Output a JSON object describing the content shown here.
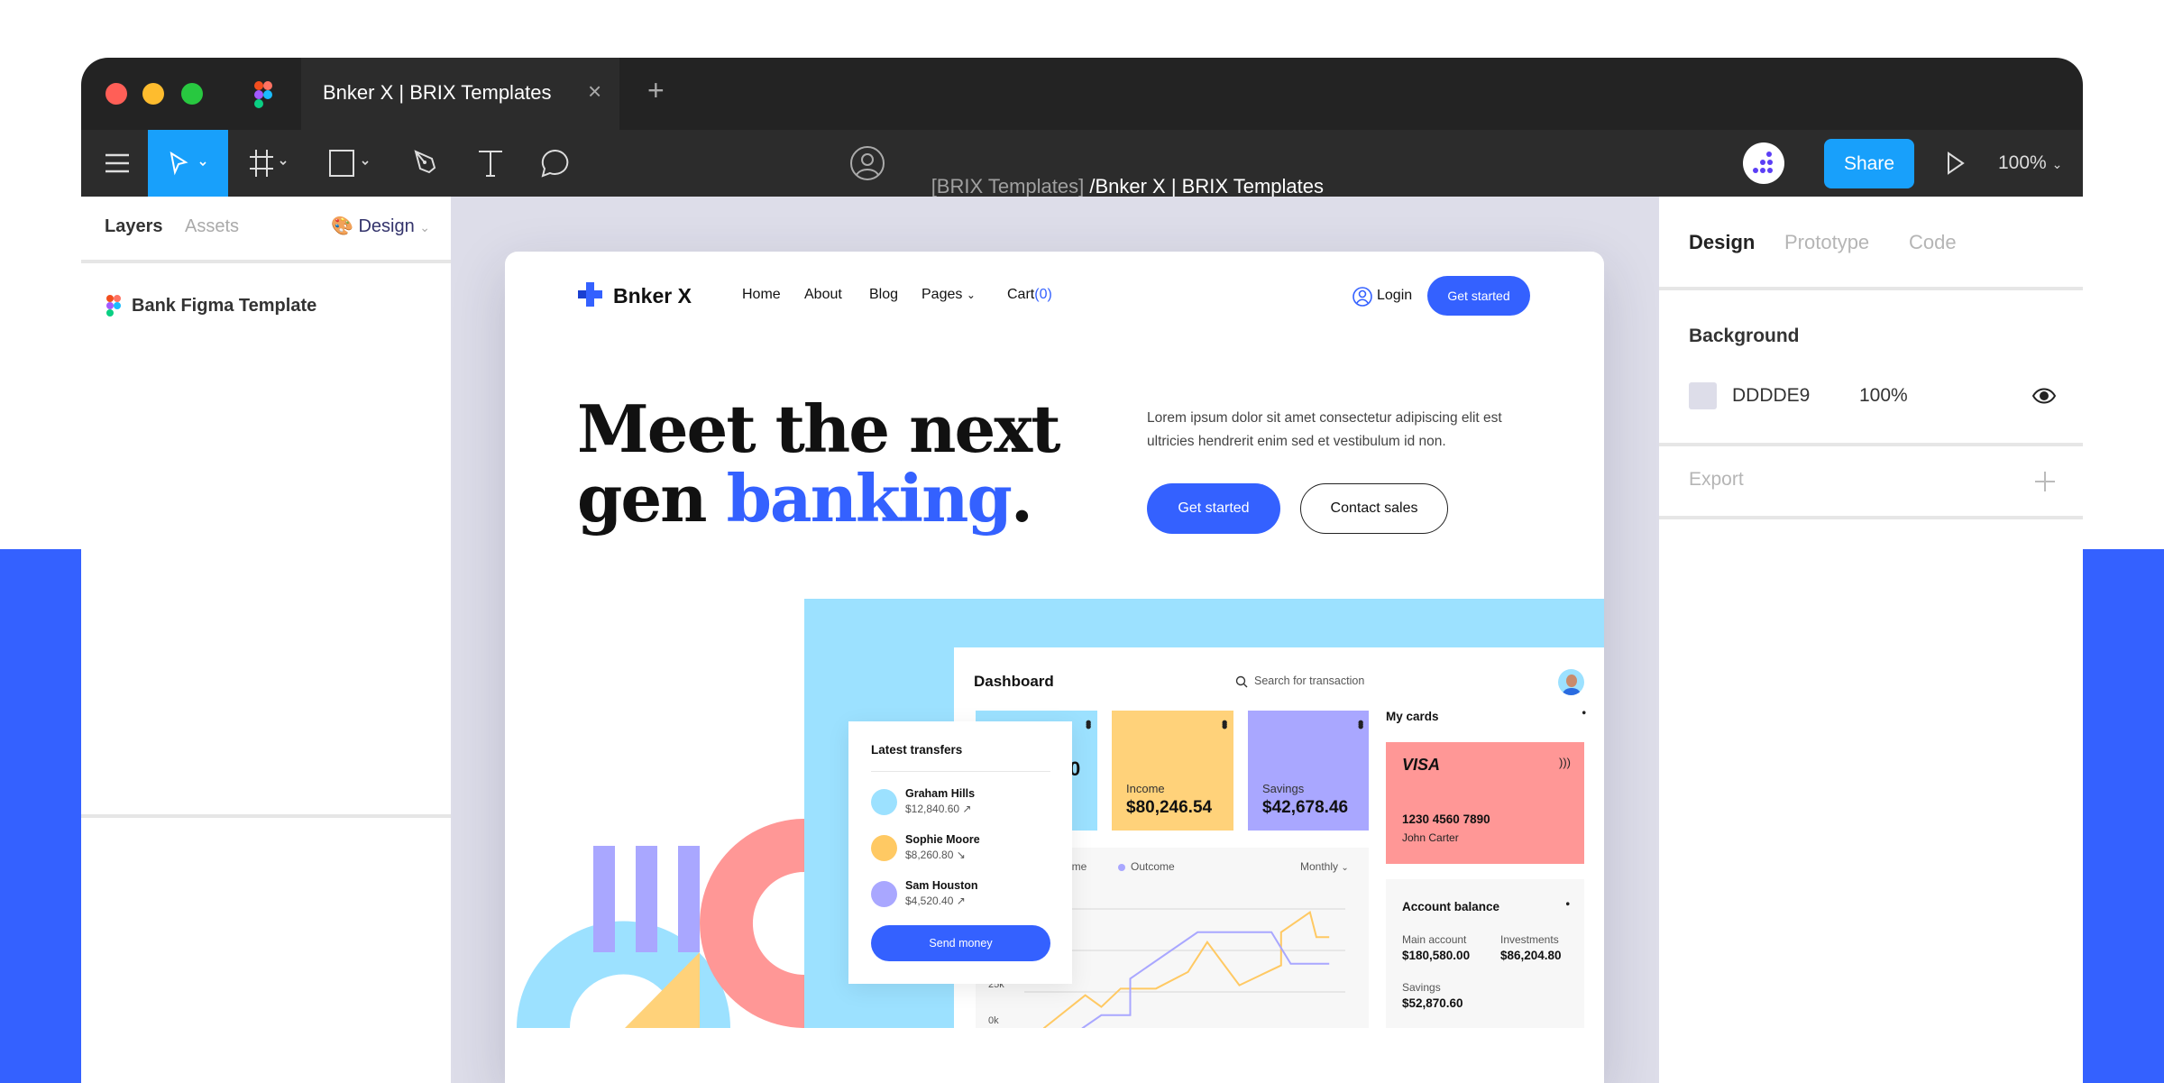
{
  "window": {
    "tab_title": "Bnker X | BRIX Templates",
    "close_glyph": "×",
    "new_tab_glyph": "+"
  },
  "toolbar": {
    "breadcrumb_team": "[BRIX Templates]",
    "breadcrumb_file": " /Bnker X | BRIX Templates",
    "share": "Share",
    "zoom": "100%"
  },
  "left_panel": {
    "tabs": [
      "Layers",
      "Assets"
    ],
    "page_selector": "Design",
    "layer": "Bank Figma Template"
  },
  "right_panel": {
    "tabs": [
      "Design",
      "Prototype",
      "Code"
    ],
    "background_title": "Background",
    "bg_hex": "DDDDE9",
    "bg_opacity": "100%",
    "bg_color": "#DDDDE9",
    "export": "Export"
  },
  "site": {
    "brand": "Bnker X",
    "nav": [
      "Home",
      "About",
      "Blog",
      "Pages"
    ],
    "cart_label": "Cart",
    "cart_count": "(0)",
    "login": "Login",
    "get_started": "Get started",
    "headline_1": "Meet the next",
    "headline_2a": "gen ",
    "headline_2b": "banking",
    "headline_2c": ".",
    "paragraph": "Lorem ipsum dolor sit amet consectetur adipiscing elit est ultricies hendrerit enim sed et vestibulum id non.",
    "cta_primary": "Get started",
    "cta_secondary": "Contact sales",
    "accent": "#3461ff"
  },
  "dashboard": {
    "title": "Dashboard",
    "search_placeholder": "Search for transaction",
    "stats": [
      {
        "label": "",
        "value": "0"
      },
      {
        "label": "Income",
        "value": "$80,246.54"
      },
      {
        "label": "Savings",
        "value": "$42,678.46"
      }
    ],
    "my_cards": "My cards",
    "card": {
      "brand": "VISA",
      "number": "1230 4560 7890",
      "holder": "John Carter"
    },
    "balance": {
      "title": "Account balance",
      "items": [
        {
          "label": "Main account",
          "value": "$180,580.00"
        },
        {
          "label": "Investments",
          "value": "$86,204.80"
        },
        {
          "label": "Savings",
          "value": "$52,870.60"
        }
      ]
    },
    "transfers": {
      "title": "Latest transfers",
      "items": [
        {
          "name": "Graham Hills",
          "amount": "$12,840.60 ↗"
        },
        {
          "name": "Sophie Moore",
          "amount": "$8,260.80 ↘"
        },
        {
          "name": "Sam Houston",
          "amount": "$4,520.40 ↗"
        }
      ],
      "button": "Send money"
    }
  },
  "chart_data": {
    "type": "line",
    "legend": [
      "Income",
      "Outcome"
    ],
    "period": "Monthly",
    "y_ticks": [
      "0k",
      "25k"
    ],
    "ylim": [
      0,
      100
    ],
    "grid": true,
    "series": [
      {
        "name": "Income",
        "color": "#ffc963",
        "points": [
          [
            6,
            3
          ],
          [
            19,
            23
          ],
          [
            24,
            16
          ],
          [
            30,
            27
          ],
          [
            41,
            27
          ],
          [
            51,
            37
          ],
          [
            57,
            55
          ],
          [
            67,
            29
          ],
          [
            80,
            41
          ],
          [
            80,
            61
          ],
          [
            89,
            73
          ],
          [
            91,
            58
          ],
          [
            95,
            58
          ]
        ]
      },
      {
        "name": "Outcome",
        "color": "#a9a7ff",
        "points": [
          [
            18,
            3
          ],
          [
            24,
            11
          ],
          [
            33,
            11
          ],
          [
            33,
            33
          ],
          [
            54,
            61
          ],
          [
            77,
            61
          ],
          [
            83,
            42
          ],
          [
            95,
            42
          ]
        ]
      }
    ]
  }
}
